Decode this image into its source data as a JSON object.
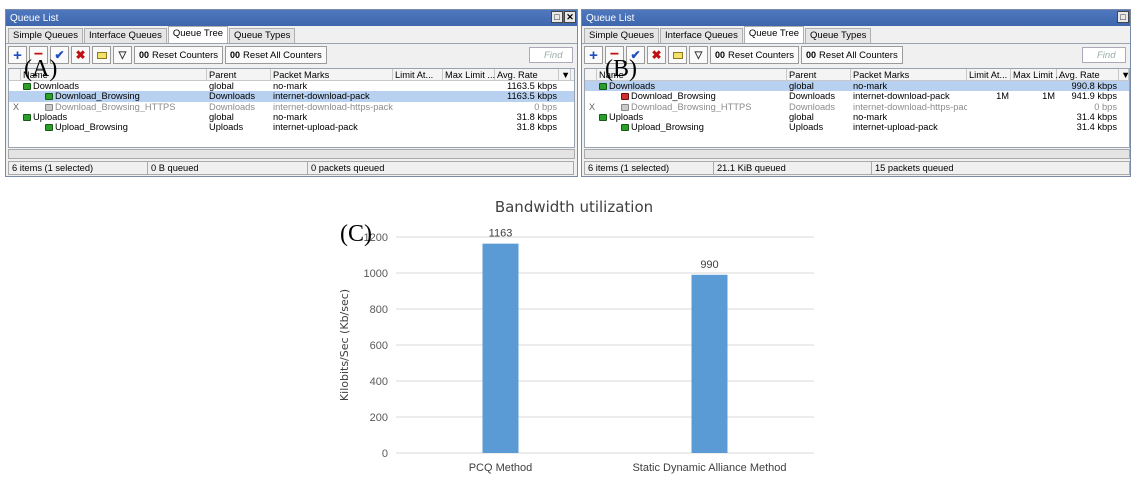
{
  "panel_labels": {
    "a": "(A)",
    "b": "(B)",
    "c": "(C)"
  },
  "icons": [
    "add-icon",
    "remove-icon",
    "enable-icon",
    "disable-icon",
    "comment-icon",
    "filter-icon",
    "reset-counters-icon",
    "reset-all-counters-icon"
  ],
  "colors": {
    "titlebar": "#4472c4",
    "selected_row": "#b8d1f0",
    "bar": "#5b9bd5",
    "queue_icon": "#2aa02a",
    "queue_icon_red": "#d23030"
  },
  "window_a": {
    "title": "Queue List",
    "tabs": [
      "Simple Queues",
      "Interface Queues",
      "Queue Tree",
      "Queue Types"
    ],
    "active_tab": "Queue Tree",
    "toolbar": {
      "reset_counters": "Reset Counters",
      "reset_all": "Reset All Counters",
      "find_placeholder": "Find",
      "oo": "00"
    },
    "columns": [
      "Name",
      "Parent",
      "Packet Marks",
      "Limit At...",
      "Max Limit ...",
      "Avg. Rate"
    ],
    "rows": [
      {
        "flag": "",
        "name": "Downloads",
        "parent": "global",
        "marks": "no-mark",
        "limit_at": "",
        "max_limit": "",
        "avg_rate": "1163.5 kbps",
        "indent": 0,
        "selected": false,
        "disabled": false,
        "icon": "green"
      },
      {
        "flag": "",
        "name": "Download_Browsing",
        "parent": "Downloads",
        "marks": "internet-download-pack",
        "limit_at": "",
        "max_limit": "",
        "avg_rate": "1163.5 kbps",
        "indent": 1,
        "selected": true,
        "disabled": false,
        "icon": "green"
      },
      {
        "flag": "X",
        "name": "Download_Browsing_HTTPS",
        "parent": "Downloads",
        "marks": "internet-download-https-pack",
        "limit_at": "",
        "max_limit": "",
        "avg_rate": "0 bps",
        "indent": 1,
        "selected": false,
        "disabled": true,
        "icon": "grey"
      },
      {
        "flag": "",
        "name": "Uploads",
        "parent": "global",
        "marks": "no-mark",
        "limit_at": "",
        "max_limit": "",
        "avg_rate": "31.8 kbps",
        "indent": 0,
        "selected": false,
        "disabled": false,
        "icon": "green"
      },
      {
        "flag": "",
        "name": "Upload_Browsing",
        "parent": "Uploads",
        "marks": "internet-upload-pack",
        "limit_at": "",
        "max_limit": "",
        "avg_rate": "31.8 kbps",
        "indent": 1,
        "selected": false,
        "disabled": false,
        "icon": "green"
      }
    ],
    "status": {
      "items": "6 items (1 selected)",
      "queued_bytes": "0 B queued",
      "queued_packets": "0 packets queued"
    }
  },
  "window_b": {
    "title": "Queue List",
    "tabs": [
      "Simple Queues",
      "Interface Queues",
      "Queue Tree",
      "Queue Types"
    ],
    "active_tab": "Queue Tree",
    "toolbar": {
      "reset_counters": "Reset Counters",
      "reset_all": "Reset All Counters",
      "find_placeholder": "Find",
      "oo": "00"
    },
    "columns": [
      "Name",
      "Parent",
      "Packet Marks",
      "Limit At...",
      "Max Limit ...",
      "Avg. Rate"
    ],
    "rows": [
      {
        "flag": "",
        "name": "Downloads",
        "parent": "global",
        "marks": "no-mark",
        "limit_at": "",
        "max_limit": "",
        "avg_rate": "990.8 kbps",
        "indent": 0,
        "selected": true,
        "disabled": false,
        "icon": "green"
      },
      {
        "flag": "",
        "name": "Download_Browsing",
        "parent": "Downloads",
        "marks": "internet-download-pack",
        "limit_at": "1M",
        "max_limit": "1M",
        "avg_rate": "941.9 kbps",
        "indent": 1,
        "selected": false,
        "disabled": false,
        "icon": "red"
      },
      {
        "flag": "X",
        "name": "Download_Browsing_HTTPS",
        "parent": "Downloads",
        "marks": "internet-download-https-pack",
        "limit_at": "",
        "max_limit": "",
        "avg_rate": "0 bps",
        "indent": 1,
        "selected": false,
        "disabled": true,
        "icon": "grey"
      },
      {
        "flag": "",
        "name": "Uploads",
        "parent": "global",
        "marks": "no-mark",
        "limit_at": "",
        "max_limit": "",
        "avg_rate": "31.4 kbps",
        "indent": 0,
        "selected": false,
        "disabled": false,
        "icon": "green"
      },
      {
        "flag": "",
        "name": "Upload_Browsing",
        "parent": "Uploads",
        "marks": "internet-upload-pack",
        "limit_at": "",
        "max_limit": "",
        "avg_rate": "31.4 kbps",
        "indent": 1,
        "selected": false,
        "disabled": false,
        "icon": "green"
      }
    ],
    "status": {
      "items": "6 items (1 selected)",
      "queued_bytes": "21.1 KiB queued",
      "queued_packets": "15 packets queued"
    }
  },
  "chart_data": {
    "type": "bar",
    "title": "Bandwidth utilization",
    "ylabel": "Kilobits/Sec (Kb/sec)",
    "xlabel": "",
    "categories": [
      "PCQ Method",
      "Static Dynamic Alliance Method"
    ],
    "values": [
      1163,
      990
    ],
    "data_labels": [
      "1163",
      "990"
    ],
    "ylim": [
      0,
      1200
    ],
    "yticks": [
      0,
      200,
      400,
      600,
      800,
      1000,
      1200
    ],
    "ytick_labels": [
      "0",
      "200",
      "400",
      "600",
      "800",
      "1000",
      "1200"
    ],
    "grid": true,
    "legend": "none"
  }
}
